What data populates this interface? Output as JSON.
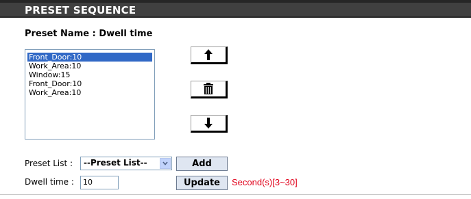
{
  "section": {
    "title": "PRESET SEQUENCE"
  },
  "preset_name": "Preset Name : Dwell time",
  "sequence_list": {
    "items": [
      "Front_Door:10",
      "Work_Area:10",
      "Window:15",
      "Front_Door:10",
      "Work_Area:10"
    ],
    "selected_index": 0
  },
  "controls": {
    "move_up_icon": "arrow-up-icon",
    "delete_icon": "trash-icon",
    "move_down_icon": "arrow-down-icon"
  },
  "form": {
    "preset_list_label": "Preset List :",
    "preset_list_value": "--Preset List--",
    "add_button": "Add",
    "dwell_time_label": "Dwell time :",
    "dwell_time_value": "10",
    "update_button": "Update",
    "range_hint": "Second(s)[3~30]"
  },
  "colors": {
    "header_bg": "#404040",
    "selection": "#3169c6",
    "hint": "#e1001a"
  }
}
